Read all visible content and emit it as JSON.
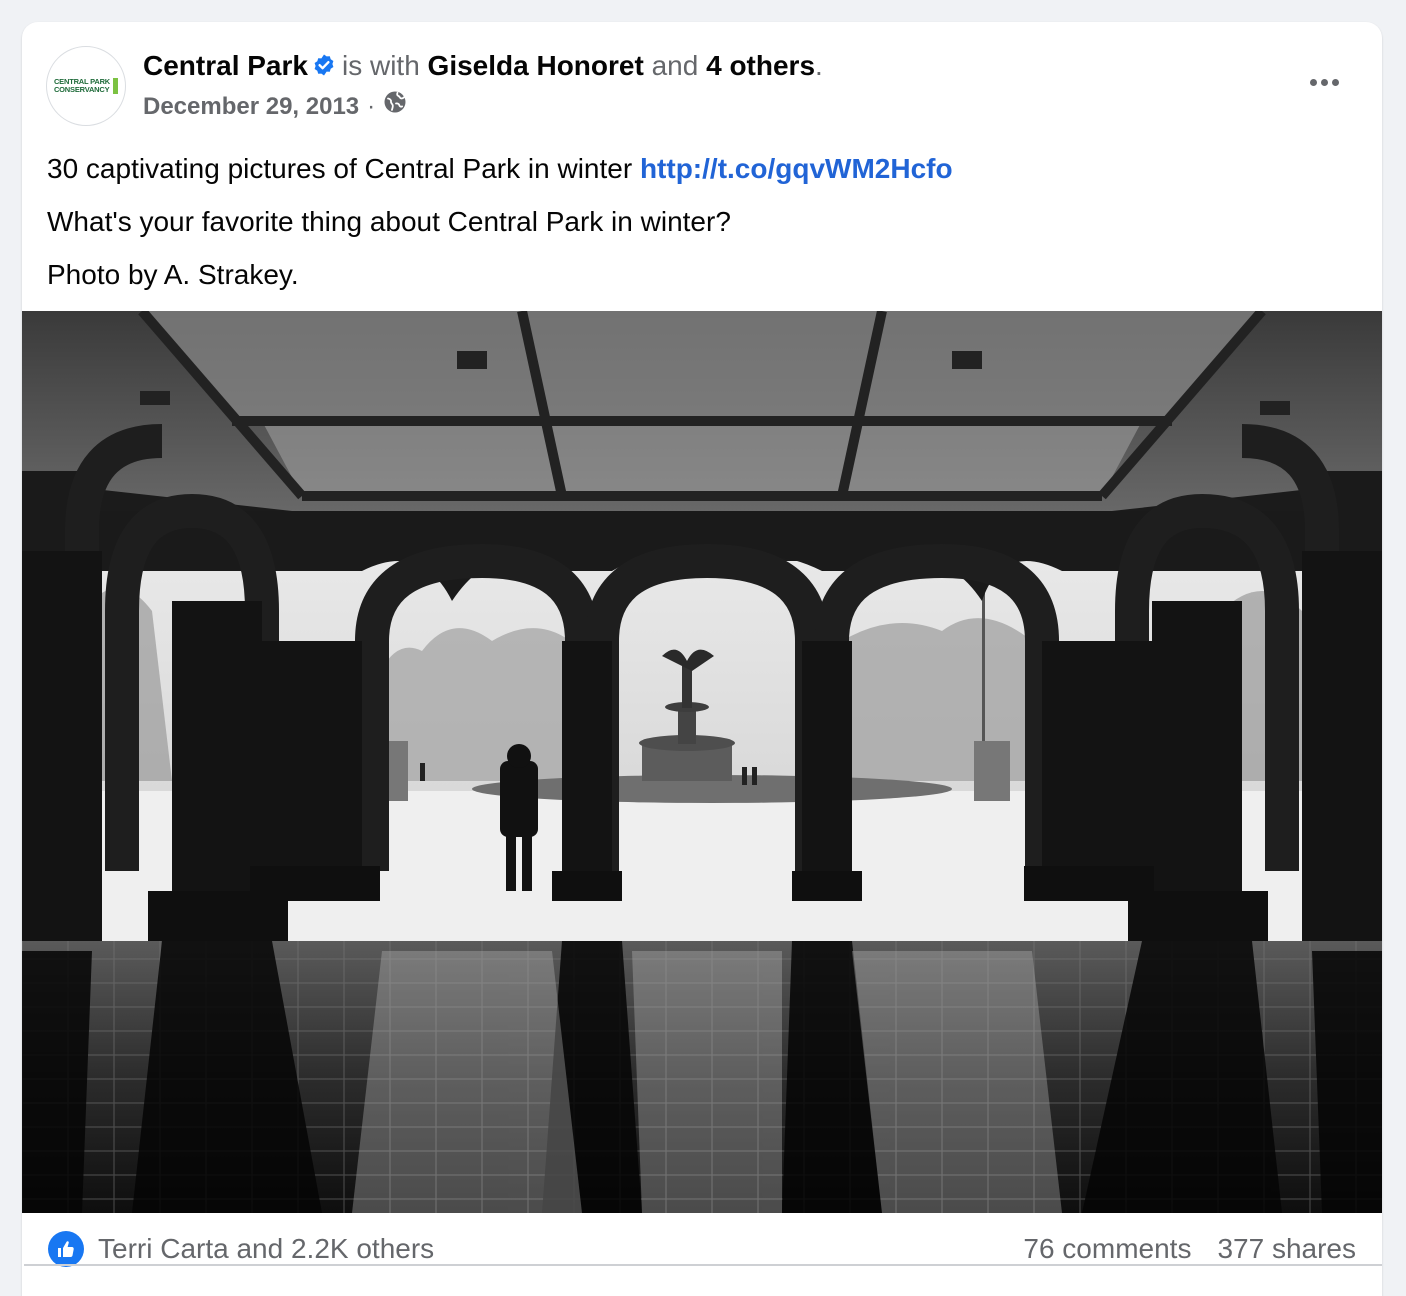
{
  "post": {
    "page_name": "Central Park",
    "with_text": "is with",
    "tagged_person": "Giselda Honoret",
    "and_text": "and",
    "others_text": "4 others",
    "period": ".",
    "date": "December 29, 2013",
    "separator": "·",
    "privacy_icon": "globe-icon",
    "verified_icon": "verified-badge-icon",
    "avatar_logo_text_line1": "CENTRAL PARK",
    "avatar_logo_text_line2": "CONSERVANCY",
    "text_line1_prefix": "30 captivating pictures of Central Park in winter ",
    "link": "http://t.co/gqvWM2Hcfo",
    "text_line2": "What's your favorite thing about Central Park in winter?",
    "text_line3": "Photo by A. Strakey."
  },
  "engagement": {
    "reaction_icon": "like-icon",
    "reactors": "Terri Carta and 2.2K others",
    "comments": "76 comments",
    "shares": "377 shares"
  },
  "colors": {
    "link": "#2164d6",
    "secondary_text": "#65676b",
    "like_blue": "#1877f2",
    "verified_blue": "#1877f2",
    "logo_green": "#1f6b3a"
  }
}
